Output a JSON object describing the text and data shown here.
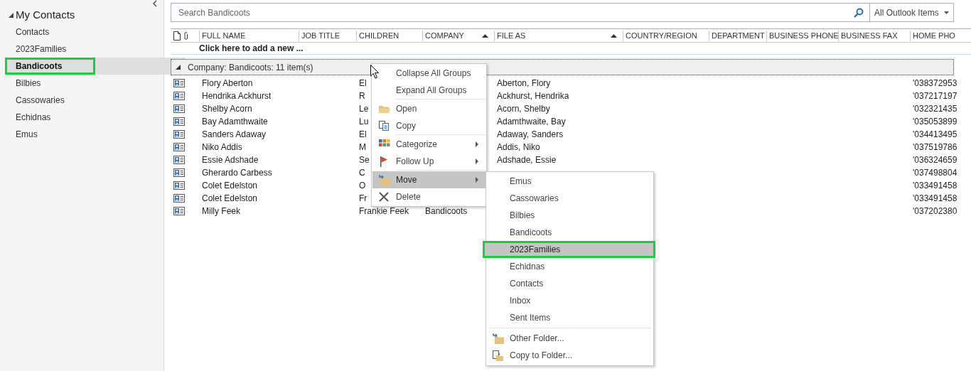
{
  "sidebar": {
    "title": "My Contacts",
    "expanded": true,
    "items": [
      {
        "label": "Contacts",
        "selected": false,
        "annotated": false
      },
      {
        "label": "2023Families",
        "selected": false,
        "annotated": false
      },
      {
        "label": "Bandicoots",
        "selected": true,
        "annotated": true
      },
      {
        "label": "Bilbies",
        "selected": false,
        "annotated": false
      },
      {
        "label": "Cassowaries",
        "selected": false,
        "annotated": false
      },
      {
        "label": "Echidnas",
        "selected": false,
        "annotated": false
      },
      {
        "label": "Emus",
        "selected": false,
        "annotated": false
      }
    ]
  },
  "search": {
    "placeholder": "Search Bandicoots",
    "scope": "All Outlook Items"
  },
  "table": {
    "columns": [
      {
        "label": "FULL NAME",
        "sorted": false
      },
      {
        "label": "JOB TITLE",
        "sorted": false
      },
      {
        "label": "CHILDREN",
        "sorted": false
      },
      {
        "label": "COMPANY",
        "sorted": true
      },
      {
        "label": "FILE AS",
        "sorted": true
      },
      {
        "label": "COUNTRY/REGION",
        "sorted": false
      },
      {
        "label": "DEPARTMENT",
        "sorted": false
      },
      {
        "label": "BUSINESS PHONE",
        "sorted": false
      },
      {
        "label": "BUSINESS FAX",
        "sorted": false
      },
      {
        "label": "HOME PHO",
        "sorted": false
      }
    ],
    "new_row": "Click here to add a new ...",
    "group": {
      "label": "Company: Bandicoots: 11 item(s)",
      "expanded": true
    },
    "rows": [
      {
        "full_name": "Flory Aberton",
        "children": "El",
        "company": "",
        "file_as": "Aberton, Flory",
        "home_phone": "'038372953"
      },
      {
        "full_name": "Hendrika Ackhurst",
        "children": "R",
        "company": "",
        "file_as": "Ackhurst, Hendrika",
        "home_phone": "'037217197"
      },
      {
        "full_name": "Shelby Acorn",
        "children": "Le",
        "company": "",
        "file_as": "Acorn, Shelby",
        "home_phone": "'032321435"
      },
      {
        "full_name": "Bay Adamthwaite",
        "children": "Lu",
        "company": "",
        "file_as": "Adamthwaite, Bay",
        "home_phone": "'035053899"
      },
      {
        "full_name": "Sanders Adaway",
        "children": "El",
        "company": "",
        "file_as": "Adaway, Sanders",
        "home_phone": "'034413495"
      },
      {
        "full_name": "Niko Addis",
        "children": "M",
        "company": "",
        "file_as": "Addis, Niko",
        "home_phone": "'037519786"
      },
      {
        "full_name": "Essie Adshade",
        "children": "Se",
        "company": "",
        "file_as": "Adshade, Essie",
        "home_phone": "'036324659"
      },
      {
        "full_name": "Gherardo Carbess",
        "children": "C",
        "company": "",
        "file_as": "",
        "home_phone": "'037498804"
      },
      {
        "full_name": "Colet Edelston",
        "children": "O",
        "company": "",
        "file_as": "",
        "home_phone": "'033491458"
      },
      {
        "full_name": "Colet Edelston",
        "children": "Fr",
        "company": "",
        "file_as": "",
        "home_phone": "'033491458"
      },
      {
        "full_name": "Milly Feek",
        "children": "Frankie Feek",
        "company": "Bandicoots",
        "file_as": "",
        "home_phone": "'037202380"
      }
    ]
  },
  "context_menu": {
    "groups": [
      [
        {
          "label": "Collapse All Groups",
          "kind": "plain",
          "submenu": false,
          "selected": false
        },
        {
          "label": "Expand All Groups",
          "kind": "plain",
          "submenu": false,
          "selected": false
        }
      ],
      [
        {
          "label": "Open",
          "kind": "open",
          "submenu": false,
          "selected": false
        },
        {
          "label": "Copy",
          "kind": "copy",
          "submenu": false,
          "selected": false
        }
      ],
      [
        {
          "label": "Categorize",
          "kind": "categorize",
          "submenu": true,
          "selected": false
        },
        {
          "label": "Follow Up",
          "kind": "flag",
          "submenu": true,
          "selected": false
        }
      ],
      [
        {
          "label": "Move",
          "kind": "move",
          "submenu": true,
          "selected": true
        },
        {
          "label": "Delete",
          "kind": "delete",
          "submenu": false,
          "selected": false
        }
      ]
    ]
  },
  "move_submenu": {
    "folders": [
      {
        "label": "Emus",
        "selected": false,
        "annotated": false
      },
      {
        "label": "Cassowaries",
        "selected": false,
        "annotated": false
      },
      {
        "label": "Bilbies",
        "selected": false,
        "annotated": false
      },
      {
        "label": "Bandicoots",
        "selected": false,
        "annotated": false
      },
      {
        "label": "2023Families",
        "selected": true,
        "annotated": true
      },
      {
        "label": "Echidnas",
        "selected": false,
        "annotated": false
      },
      {
        "label": "Contacts",
        "selected": false,
        "annotated": false
      },
      {
        "label": "Inbox",
        "selected": false,
        "annotated": false
      },
      {
        "label": "Sent Items",
        "selected": false,
        "annotated": false
      }
    ],
    "actions": [
      {
        "label": "Other Folder...",
        "kind": "move"
      },
      {
        "label": "Copy to Folder...",
        "kind": "copyfolder"
      }
    ]
  }
}
